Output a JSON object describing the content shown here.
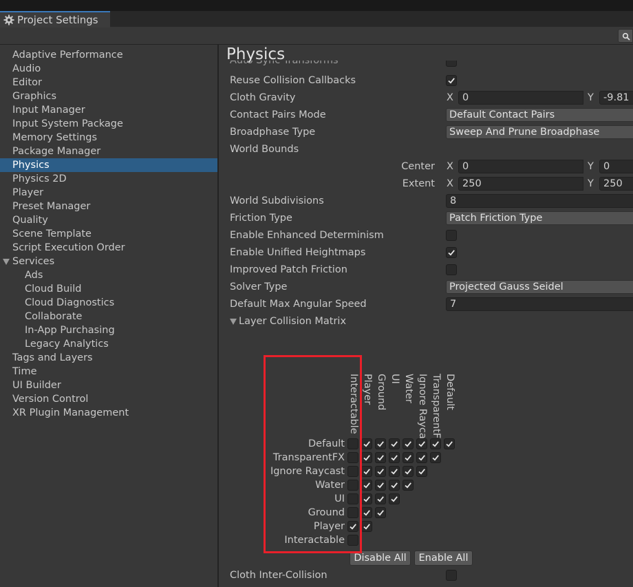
{
  "window": {
    "tab_title": "Project Settings",
    "tab_icon": "gear-icon"
  },
  "colors": {
    "accent": "#3a79bb",
    "selection": "#2c5d87",
    "highlight_box": "#e8202a"
  },
  "sidebar": {
    "items": [
      {
        "label": "Adaptive Performance"
      },
      {
        "label": "Audio"
      },
      {
        "label": "Editor"
      },
      {
        "label": "Graphics"
      },
      {
        "label": "Input Manager"
      },
      {
        "label": "Input System Package"
      },
      {
        "label": "Memory Settings"
      },
      {
        "label": "Package Manager"
      },
      {
        "label": "Physics",
        "selected": true
      },
      {
        "label": "Physics 2D"
      },
      {
        "label": "Player"
      },
      {
        "label": "Preset Manager"
      },
      {
        "label": "Quality"
      },
      {
        "label": "Scene Template"
      },
      {
        "label": "Script Execution Order"
      },
      {
        "label": "Services",
        "expanded": true
      },
      {
        "label": "Ads",
        "sub": true
      },
      {
        "label": "Cloud Build",
        "sub": true
      },
      {
        "label": "Cloud Diagnostics",
        "sub": true
      },
      {
        "label": "Collaborate",
        "sub": true
      },
      {
        "label": "In-App Purchasing",
        "sub": true
      },
      {
        "label": "Legacy Analytics",
        "sub": true
      },
      {
        "label": "Tags and Layers"
      },
      {
        "label": "Time"
      },
      {
        "label": "UI Builder"
      },
      {
        "label": "Version Control"
      },
      {
        "label": "XR Plugin Management"
      }
    ]
  },
  "main": {
    "title": "Physics",
    "cut_off_label": "Auto Sync Transforms",
    "reuse_collision_callbacks": {
      "label": "Reuse Collision Callbacks",
      "checked": true
    },
    "cloth_gravity": {
      "label": "Cloth Gravity",
      "x_axis": "X",
      "x": "0",
      "y_axis": "Y",
      "y": "-9.81"
    },
    "contact_pairs_mode": {
      "label": "Contact Pairs Mode",
      "value": "Default Contact Pairs"
    },
    "broadphase_type": {
      "label": "Broadphase Type",
      "value": "Sweep And Prune Broadphase"
    },
    "world_bounds": {
      "label": "World Bounds",
      "center": {
        "label": "Center",
        "x_axis": "X",
        "x": "0",
        "y_axis": "Y",
        "y": "0"
      },
      "extent": {
        "label": "Extent",
        "x_axis": "X",
        "x": "250",
        "y_axis": "Y",
        "y": "250"
      }
    },
    "world_subdivisions": {
      "label": "World Subdivisions",
      "value": "8"
    },
    "friction_type": {
      "label": "Friction Type",
      "value": "Patch Friction Type"
    },
    "enhanced_determinism": {
      "label": "Enable Enhanced Determinism",
      "checked": false
    },
    "unified_heightmaps": {
      "label": "Enable Unified Heightmaps",
      "checked": true
    },
    "improved_patch_friction": {
      "label": "Improved Patch Friction",
      "checked": false
    },
    "solver_type": {
      "label": "Solver Type",
      "value": "Projected Gauss Seidel"
    },
    "max_angular_speed": {
      "label": "Default Max Angular Speed",
      "value": "7"
    },
    "layer_matrix": {
      "label": "Layer Collision Matrix",
      "rows": [
        "Default",
        "TransparentFX",
        "Ignore Raycast",
        "Water",
        "UI",
        "Ground",
        "Player",
        "Interactable"
      ],
      "columns": [
        "Interactable",
        "Player",
        "Ground",
        "UI",
        "Water",
        "Ignore Raycast",
        "TransparentFX",
        "Default"
      ],
      "cells": [
        [
          false,
          true,
          true,
          true,
          true,
          true,
          true,
          true
        ],
        [
          false,
          true,
          true,
          true,
          true,
          true,
          true
        ],
        [
          false,
          true,
          true,
          true,
          true,
          true
        ],
        [
          false,
          true,
          true,
          true,
          true
        ],
        [
          false,
          true,
          true,
          true
        ],
        [
          false,
          true,
          true
        ],
        [
          true,
          true
        ],
        [
          false
        ]
      ],
      "disable_all": "Disable All",
      "enable_all": "Enable All"
    },
    "cloth_inter_collision": {
      "label": "Cloth Inter-Collision",
      "checked": false
    }
  }
}
